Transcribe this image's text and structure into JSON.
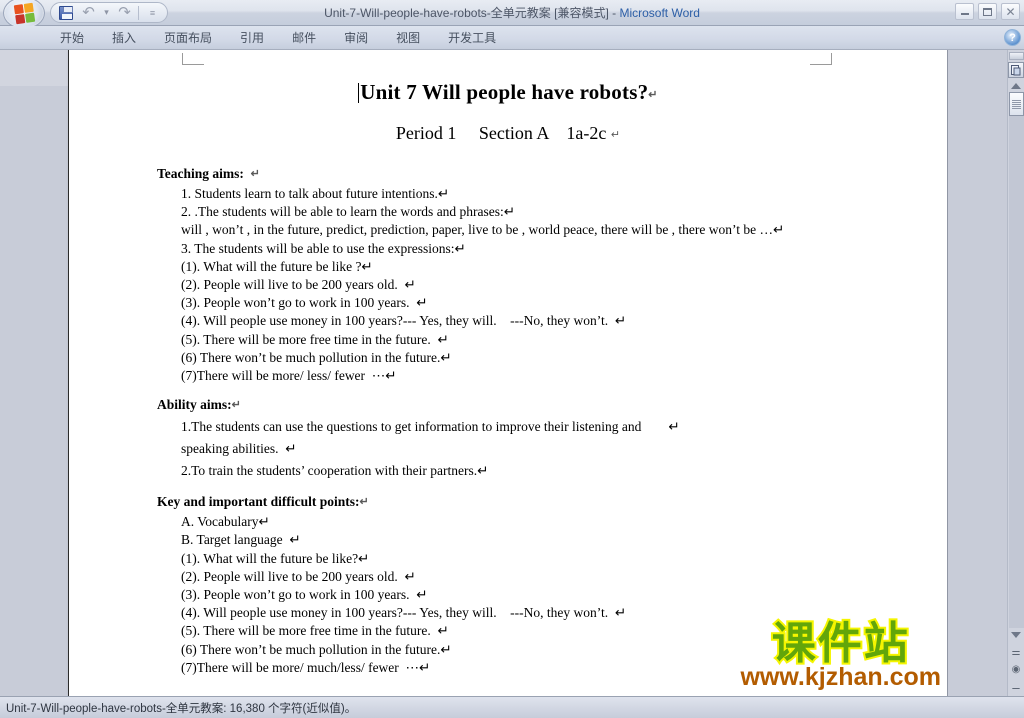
{
  "window": {
    "title_file": "Unit-7-Will-people-have-robots-全单元教案 [兼容模式]",
    "title_dash": " - ",
    "app_name": "Microsoft Word",
    "minimize_label": "最小化",
    "restore_label": "还原",
    "close_label": "关闭",
    "office_button_label": "Office 按钮"
  },
  "quick_access": {
    "save_icon": "floppy-disk-icon",
    "undo_icon": "undo-arrow-icon",
    "undo_dropdown_icon": "chevron-down-icon",
    "redo_icon": "redo-arrow-icon",
    "customize_icon": "customize-qat-icon"
  },
  "ribbon": {
    "tabs": [
      {
        "label": "开始",
        "active": false
      },
      {
        "label": "插入",
        "active": false
      },
      {
        "label": "页面布局",
        "active": false
      },
      {
        "label": "引用",
        "active": false
      },
      {
        "label": "邮件",
        "active": false
      },
      {
        "label": "审阅",
        "active": false
      },
      {
        "label": "视图",
        "active": false
      },
      {
        "label": "开发工具",
        "active": false
      }
    ],
    "help_label": "?"
  },
  "document": {
    "title": "Unit 7 Will people have robots?",
    "title_pilcrow": "↵",
    "subtitle": "Period 1     Section A    1a-2c ",
    "subtitle_pilcrow": "↵",
    "sections": [
      {
        "heading": "Teaching aims:",
        "heading_pilcrow": "↵",
        "lines": [
          "1. Students learn to talk about future intentions.↵",
          "2. .The students will be able to learn the words and phrases:↵",
          "will , won’t , in the future, predict, prediction, paper, live to be , world peace, there will be , there won’t be …↵",
          "3. The students will be able to use the expressions:↵",
          "(1). What will the future be like ?↵",
          "(2). People will live to be 200 years old.  ↵",
          "(3). People won’t go to work in 100 years.  ↵",
          "(4). Will people use money in 100 years?--- Yes, they will.    ---No, they won’t.  ↵",
          "(5). There will be more free time in the future.  ↵",
          "(6) There won’t be much pollution in the future.↵",
          "(7)There will be more/ less/ fewer  ⋯↵"
        ]
      },
      {
        "heading": "Ability aims:",
        "heading_pilcrow": "↵",
        "lines": [
          "1.The students can use the questions to get information to improve their listening and        ↵",
          "speaking abilities.  ↵",
          "2.To train the students’ cooperation with their partners.↵"
        ]
      },
      {
        "heading": "Key and important  difficult points:",
        "heading_pilcrow": "↵",
        "lines": [
          "A. Vocabulary↵",
          "B. Target language  ↵",
          "(1). What will the future be like?↵",
          "(2). People will live to be 200 years old.  ↵",
          "(3). People won’t go to work in 100 years.  ↵",
          "(4). Will people use money in 100 years?--- Yes, they will.    ---No, they won’t.  ↵",
          "(5). There will be more free time in the future.  ↵",
          "(6) There won’t be much pollution in the future.↵",
          "(7)There will be more/ much/less/ fewer  ⋯↵"
        ]
      }
    ]
  },
  "watermark": {
    "brand_cn": "课件站",
    "brand_url": "www.kjzhan.com",
    "brand_color": "#62a60a",
    "brand_outline": "#f5f500",
    "url_color": "#b35c00"
  },
  "scrollbar": {
    "select_browse_object_icon": "select-browse-object-icon",
    "scroll_up_icon": "triangle-up-icon",
    "scroll_down_icon": "triangle-down-icon",
    "previous_page_icon": "previous-page-icon",
    "next_page_icon": "next-page-icon",
    "split_handle_icon": "split-window-handle-icon",
    "thumb_label": "垂直滚动条滑块"
  },
  "statusbar": {
    "text": "Unit-7-Will-people-have-robots-全单元教案: 16,380 个字符(近似值)。"
  }
}
